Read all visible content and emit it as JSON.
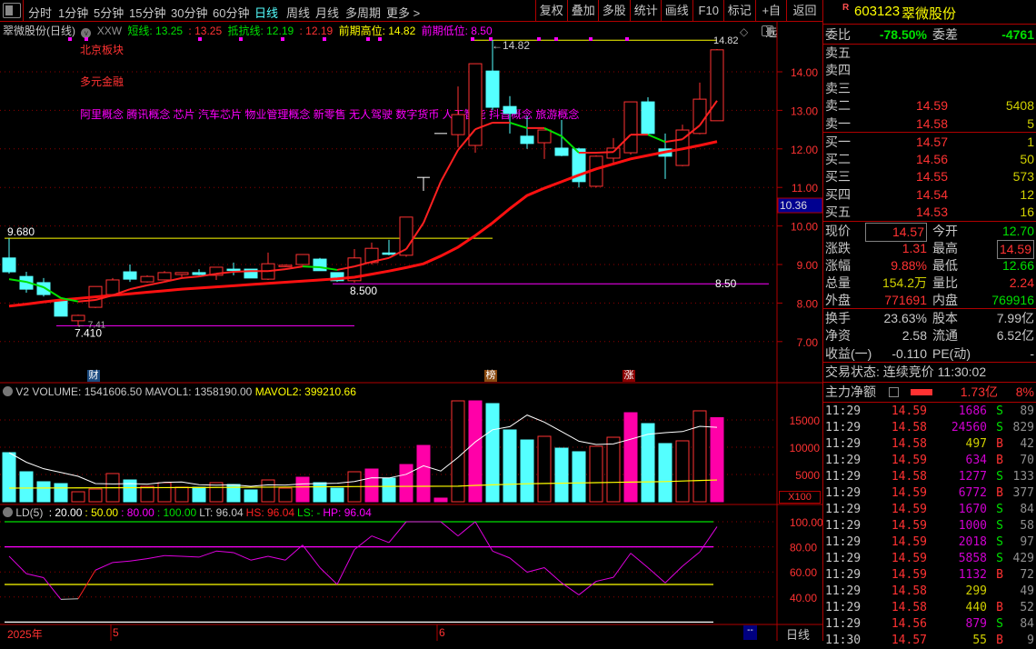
{
  "toolbar": {
    "periods": [
      "分时",
      "1分钟",
      "5分钟",
      "15分钟",
      "30分钟",
      "60分钟",
      "日线",
      "周线",
      "月线",
      "多周期",
      "更多 >"
    ],
    "active": "日线",
    "actions": [
      "复权",
      "叠加",
      "多股",
      "统计",
      "画线",
      "F10",
      "标记",
      "+自选",
      "返回"
    ]
  },
  "header": {
    "title": "翠微股份(日线)",
    "indicator": "XXW",
    "short_label": "短线: 13.25",
    "short_val": ": 13.25",
    "resist_label": "抵抗线: 12.19",
    "resist_val": ": 12.19",
    "high_label": "前期高位: 14.82",
    "low_label": "前期低位: 8.50"
  },
  "overlay": {
    "sector": "北京板块",
    "industry": "多元金融",
    "concepts": "阿里概念 腾讯概念 芯片 汽车芯片 物业管理概念 新零售 无人驾驶 数字货币 人工智能 抖音概念 旅游概念"
  },
  "events": [
    {
      "i": 5,
      "text": "财",
      "color": "#1a4a80"
    },
    {
      "i": 28,
      "text": "榜",
      "color": "#8b4a10"
    },
    {
      "i": 36,
      "text": "涨",
      "color": "#8b0000"
    }
  ],
  "chart_data": [
    {
      "type": "candlestick",
      "price_ticks": [
        "14.00",
        "13.00",
        "12.00",
        "11.00",
        "10.00",
        "9.00",
        "8.00",
        "7.00"
      ],
      "cursor_price": "10.36",
      "ylim": [
        7,
        14
      ],
      "ohlc": [
        [
          9.17,
          9.68,
          8.76,
          8.81
        ],
        [
          8.69,
          8.81,
          8.27,
          8.36
        ],
        [
          8.53,
          8.65,
          8.17,
          8.22
        ],
        [
          8.08,
          8.08,
          7.66,
          7.66
        ],
        [
          7.54,
          7.7,
          7.41,
          7.68
        ],
        [
          7.89,
          8.43,
          7.87,
          8.43
        ],
        [
          8.22,
          8.65,
          8.2,
          8.6
        ],
        [
          8.81,
          9.0,
          8.55,
          8.62
        ],
        [
          8.55,
          8.72,
          8.53,
          8.69
        ],
        [
          8.6,
          8.83,
          8.58,
          8.79
        ],
        [
          8.74,
          8.79,
          8.67,
          8.79
        ],
        [
          8.79,
          8.88,
          8.72,
          8.74
        ],
        [
          8.72,
          8.93,
          8.6,
          8.93
        ],
        [
          8.88,
          9.05,
          8.72,
          8.86
        ],
        [
          8.88,
          8.88,
          8.65,
          8.65
        ],
        [
          8.62,
          9.31,
          8.6,
          9.02
        ],
        [
          8.96,
          9.0,
          8.93,
          8.98
        ],
        [
          9.0,
          9.26,
          8.98,
          9.26
        ],
        [
          9.14,
          9.17,
          8.84,
          8.84
        ],
        [
          8.79,
          8.79,
          8.55,
          8.58
        ],
        [
          8.58,
          9.4,
          8.53,
          9.17
        ],
        [
          9.05,
          9.57,
          9.0,
          9.42
        ],
        [
          9.3,
          9.64,
          9.24,
          9.28
        ],
        [
          9.24,
          10.23,
          9.2,
          10.23
        ],
        [
          11.26,
          11.26,
          10.91,
          11.26
        ],
        [
          12.4,
          12.4,
          12.4,
          12.4
        ],
        [
          12.37,
          13.62,
          12.04,
          12.89
        ],
        [
          12.09,
          14.21,
          11.9,
          14.21
        ],
        [
          14.02,
          14.82,
          13.0,
          13.08
        ],
        [
          13.1,
          13.37,
          12.4,
          12.92
        ],
        [
          12.33,
          12.85,
          12.0,
          12.14
        ],
        [
          12.16,
          12.49,
          11.74,
          12.49
        ],
        [
          12.02,
          12.75,
          11.81,
          11.83
        ],
        [
          12.0,
          12.03,
          11.0,
          11.15
        ],
        [
          11.03,
          11.83,
          11.0,
          11.81
        ],
        [
          11.76,
          12.28,
          11.62,
          12.02
        ],
        [
          11.9,
          13.22,
          11.85,
          13.22
        ],
        [
          13.22,
          13.34,
          12.35,
          12.4
        ],
        [
          12.0,
          12.4,
          11.22,
          11.81
        ],
        [
          11.57,
          12.63,
          11.55,
          12.49
        ],
        [
          12.4,
          13.72,
          12.38,
          13.29
        ],
        [
          12.73,
          14.59,
          12.73,
          14.57
        ]
      ],
      "short_line": [
        8.62,
        8.55,
        8.41,
        8.13,
        8.04,
        8.08,
        8.2,
        8.36,
        8.46,
        8.55,
        8.65,
        8.69,
        8.76,
        8.81,
        8.83,
        8.83,
        8.88,
        8.95,
        8.93,
        8.86,
        8.95,
        9.07,
        9.17,
        9.4,
        10.08,
        11.15,
        11.97,
        12.51,
        12.68,
        12.68,
        12.54,
        12.54,
        12.33,
        11.9,
        11.9,
        11.92,
        12.37,
        12.37,
        12.18,
        12.25,
        12.61,
        13.25
      ],
      "resist_line": [
        7.92,
        7.97,
        8.03,
        8.08,
        8.12,
        8.16,
        8.2,
        8.24,
        8.28,
        8.32,
        8.36,
        8.39,
        8.42,
        8.45,
        8.48,
        8.51,
        8.54,
        8.57,
        8.6,
        8.63,
        8.67,
        8.75,
        8.83,
        8.92,
        9.02,
        9.22,
        9.45,
        9.75,
        10.08,
        10.45,
        10.79,
        10.98,
        11.15,
        11.32,
        11.48,
        11.61,
        11.74,
        11.83,
        11.92,
        12.0,
        12.09,
        12.19
      ],
      "levels": [
        {
          "value": 9.68,
          "from": 0,
          "to": 28,
          "color": "#ffff00",
          "label": "9.680"
        },
        {
          "value": 14.82,
          "from": 27,
          "to": 41,
          "color": "#ffff00",
          "label": "14.82",
          "label2": "←14.82"
        },
        {
          "value": 8.5,
          "from": 19,
          "to": 44,
          "color": "#ff00ff",
          "label": "8.500",
          "label2": "8.50"
        },
        {
          "value": 7.41,
          "from": 3,
          "to": 20,
          "color": "#ff00ff",
          "label": "7.410",
          "label2": "← 7.41"
        }
      ]
    },
    {
      "type": "bar",
      "title": "V2",
      "volume_label": "VOLUME: 1541606.50",
      "mavol1_label": "MAVOL1: 1358190.00",
      "mavol2_label": "MAVOL2: 399210.66",
      "unit": "X100",
      "ticks": [
        "15000",
        "10000",
        "5000"
      ],
      "values": [
        9000,
        5500,
        3670,
        3330,
        1830,
        2330,
        5170,
        4000,
        2830,
        3500,
        2670,
        2670,
        3500,
        3170,
        2170,
        4000,
        2500,
        4500,
        3500,
        2500,
        5500,
        6000,
        4330,
        6830,
        10330,
        670,
        18500,
        18500,
        18000,
        13170,
        11330,
        12000,
        9830,
        9170,
        10170,
        11830,
        16330,
        14330,
        10670,
        11170,
        16670,
        15416
      ],
      "styles": [
        "c",
        "c",
        "c",
        "c",
        "r",
        "r",
        "r",
        "c",
        "r",
        "r",
        "r",
        "c",
        "r",
        "c",
        "c",
        "r",
        "r",
        "m",
        "c",
        "c",
        "r",
        "m",
        "c",
        "m",
        "m",
        "m",
        "r",
        "m",
        "c",
        "c",
        "c",
        "r",
        "c",
        "c",
        "r",
        "r",
        "m",
        "c",
        "c",
        "r",
        "r",
        "m"
      ],
      "mavol2": [
        2500,
        2510,
        2520,
        2530,
        2540,
        2550,
        2560,
        2570,
        2580,
        2590,
        2600,
        2610,
        2620,
        2640,
        2660,
        2680,
        2700,
        2720,
        2740,
        2760,
        2780,
        2800,
        2810,
        2820,
        2830,
        2840,
        2860,
        3000,
        3100,
        3200,
        3300,
        3350,
        3400,
        3450,
        3500,
        3550,
        3600,
        3650,
        3700,
        3800,
        3900,
        3992
      ]
    },
    {
      "type": "line",
      "title": "LD(5)",
      "params": [
        {
          "text": ": 20.00",
          "color": "#ffffff"
        },
        {
          "text": ": 50.00",
          "color": "#ffff00"
        },
        {
          "text": ": 80.00",
          "color": "#ff00ff"
        },
        {
          "text": ": 100.00",
          "color": "#00e000"
        },
        {
          "text": "LT: 96.04",
          "color": "#c8c8c8"
        },
        {
          "text": "HS: 96.04",
          "color": "#ff2020"
        },
        {
          "text": "LS: -",
          "color": "#00e000"
        },
        {
          "text": "HP: 96.04",
          "color": "#ff00ff"
        }
      ],
      "ticks": [
        "100.00",
        "80.00",
        "60.00",
        "40.00"
      ],
      "ylim": [
        20,
        100
      ],
      "ref_lines": [
        {
          "v": 100,
          "color": "#00e000"
        },
        {
          "v": 80,
          "color": "#ff00ff"
        },
        {
          "v": 50,
          "color": "#ffff00"
        },
        {
          "v": 20,
          "color": "#ffffff"
        }
      ],
      "values": [
        72.5,
        58.6,
        55.4,
        38.1,
        38.6,
        61.4,
        67.5,
        68.7,
        70.6,
        73.0,
        72.5,
        71.8,
        76.6,
        75.4,
        69.4,
        72.5,
        69.4,
        81.4,
        63.4,
        50.1,
        77.8,
        88.7,
        83.4,
        100,
        100,
        100,
        88.7,
        100,
        76.6,
        71.1,
        59.8,
        63.4,
        51.3,
        41.7,
        52.5,
        55.7,
        74.9,
        63.4,
        51.3,
        64.6,
        75.9,
        96.04
      ]
    }
  ],
  "date_axis": {
    "year": "2025年",
    "m5": "5",
    "m6": "6",
    "scroll": "--",
    "period": "日线"
  },
  "quote": {
    "flag": "R",
    "code": "603123",
    "name": "翠微股份",
    "weibi_label": "委比",
    "weibi": "-78.50%",
    "weicha_label": "委差",
    "weicha": "-4761",
    "asks": [
      {
        "label": "卖五",
        "price": "",
        "vol": ""
      },
      {
        "label": "卖四",
        "price": "",
        "vol": ""
      },
      {
        "label": "卖三",
        "price": "",
        "vol": ""
      },
      {
        "label": "卖二",
        "price": "14.59",
        "vol": "5408"
      },
      {
        "label": "卖一",
        "price": "14.58",
        "vol": "5"
      }
    ],
    "bids": [
      {
        "label": "买一",
        "price": "14.57",
        "vol": "1"
      },
      {
        "label": "买二",
        "price": "14.56",
        "vol": "50"
      },
      {
        "label": "买三",
        "price": "14.55",
        "vol": "573"
      },
      {
        "label": "买四",
        "price": "14.54",
        "vol": "12"
      },
      {
        "label": "买五",
        "price": "14.53",
        "vol": "16"
      }
    ],
    "stats": [
      {
        "l": "现价",
        "v": "14.57",
        "l2": "今开",
        "v2": "12.70"
      },
      {
        "l": "涨跌",
        "v": "1.31",
        "l2": "最高",
        "v2": "14.59"
      },
      {
        "l": "涨幅",
        "v": "9.88%",
        "l2": "最低",
        "v2": "12.66"
      },
      {
        "l": "总量",
        "v": "154.2万",
        "l2": "量比",
        "v2": "2.24"
      },
      {
        "l": "外盘",
        "v": "771691",
        "l2": "内盘",
        "v2": "769916"
      },
      {
        "l": "换手",
        "v": "23.63%",
        "l2": "股本",
        "v2": "7.99亿"
      },
      {
        "l": "净资",
        "v": "2.58",
        "l2": "流通",
        "v2": "6.52亿"
      },
      {
        "l": "收益(一)",
        "v": "-0.110",
        "l2": "PE(动)",
        "v2": "-"
      }
    ],
    "status": "交易状态: 连续竞价 11:30:02",
    "main_force_label": "主力净额",
    "main_force": "1.73亿",
    "main_force_pct": "8%",
    "ticks": [
      [
        "11:29",
        "14.59",
        "1686",
        "S",
        "89"
      ],
      [
        "11:29",
        "14.58",
        "24560",
        "S",
        "829"
      ],
      [
        "11:29",
        "14.58",
        "497",
        "B",
        "42"
      ],
      [
        "11:29",
        "14.59",
        "634",
        "B",
        "70"
      ],
      [
        "11:29",
        "14.58",
        "1277",
        "S",
        "133"
      ],
      [
        "11:29",
        "14.59",
        "6772",
        "B",
        "377"
      ],
      [
        "11:29",
        "14.59",
        "1670",
        "S",
        "84"
      ],
      [
        "11:29",
        "14.59",
        "1000",
        "S",
        "58"
      ],
      [
        "11:29",
        "14.59",
        "2018",
        "S",
        "97"
      ],
      [
        "11:29",
        "14.59",
        "5858",
        "S",
        "429"
      ],
      [
        "11:29",
        "14.59",
        "1132",
        "B",
        "72"
      ],
      [
        "11:29",
        "14.58",
        "299",
        "",
        "49"
      ],
      [
        "11:29",
        "14.58",
        "440",
        "B",
        "52"
      ],
      [
        "11:29",
        "14.56",
        "879",
        "S",
        "84"
      ],
      [
        "11:30",
        "14.57",
        "55",
        "B",
        "9"
      ]
    ]
  }
}
